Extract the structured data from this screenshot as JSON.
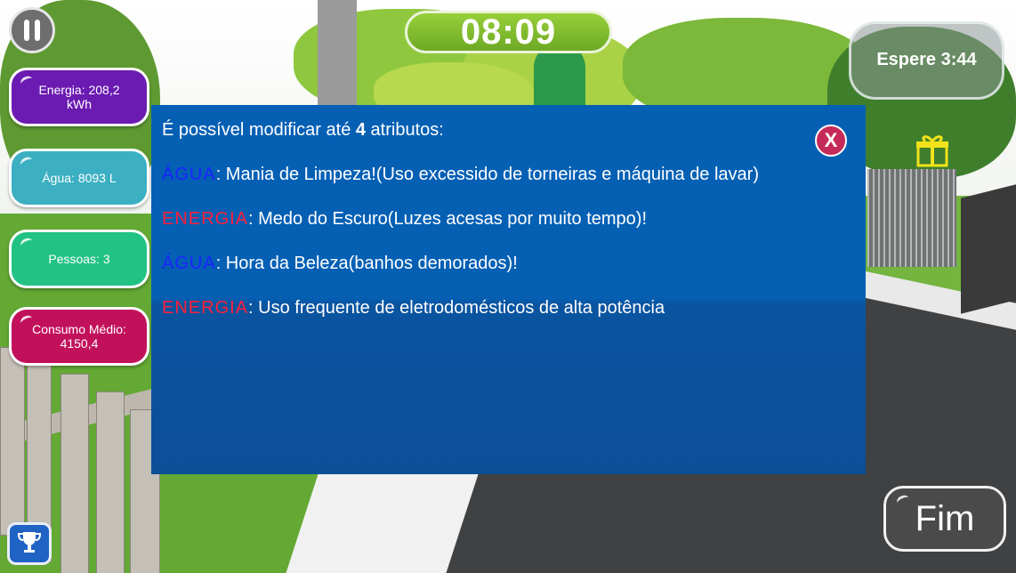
{
  "hud": {
    "timer": "08:09",
    "wait_label": "Espere 3:44"
  },
  "stats": {
    "energy": "Energia: 208,2 kWh",
    "water": "Água: 8093 L",
    "people": "Pessoas: 3",
    "avg_consumption": "Consumo Médio: 4150,4"
  },
  "modal": {
    "intro_prefix": "É possível modificar até ",
    "intro_count": "4",
    "intro_suffix": " atributos:",
    "close_label": "X",
    "attributes": [
      {
        "type": "ÁGUA",
        "text": ": Mania de Limpeza!(Uso excessido de torneiras e máquina de lavar)"
      },
      {
        "type": "ENERGIA",
        "text": ": Medo do Escuro(Luzes acesas por muito tempo)!"
      },
      {
        "type": "ÁGUA",
        "text": ": Hora da Beleza(banhos demorados)!"
      },
      {
        "type": "ENERGIA",
        "text": ": Uso frequente de eletrodomésticos de alta potência"
      }
    ]
  },
  "buttons": {
    "fim": "Fim"
  },
  "icons": {
    "pause": "pause-icon",
    "gift": "gift-icon",
    "trophy": "trophy-icon",
    "close": "close-icon"
  },
  "colors": {
    "modal_bg": "#0560b4",
    "water_keyword": "#1a23ff",
    "energy_keyword": "#ff1f3a",
    "timer_green": "#7fbf2e",
    "energy_stat": "#6b1bb1",
    "water_stat": "#3cb0c2",
    "people_stat": "#21c284",
    "avg_stat": "#c2115b"
  }
}
